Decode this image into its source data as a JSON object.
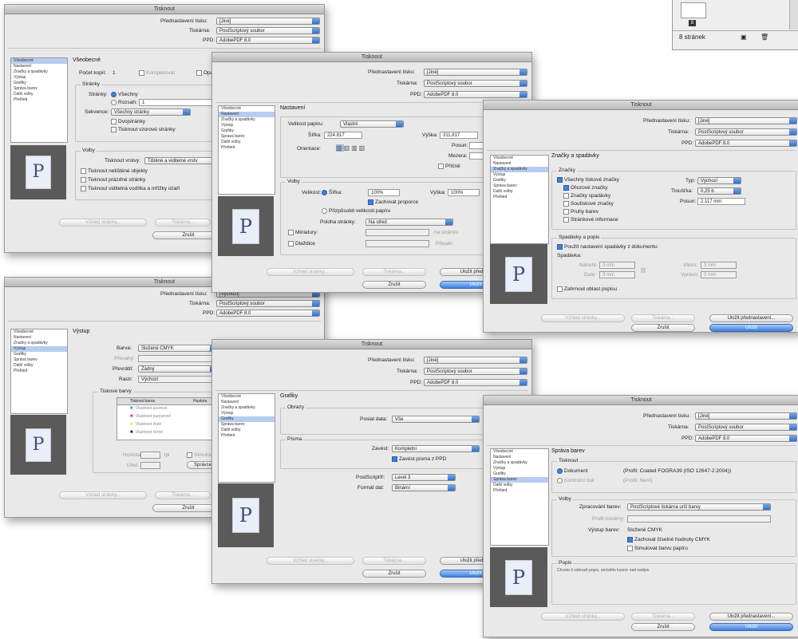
{
  "title": "Tisknout",
  "common": {
    "preset_label": "Přednastavení tisku:",
    "printer_label": "Tiskárna:",
    "ppd_label": "PPD:",
    "preset_value": "[Jiné]",
    "printer_value": "PostScriptový soubor",
    "ppd_value": "AdobePDF 8.0",
    "btn_page_setup": "Vzhled stránky...",
    "btn_printer": "Tiskárna...",
    "btn_save_preset": "Uložit přednastavení...",
    "btn_save_preset_short": "Uložit před",
    "btn_cancel": "Zrušit",
    "btn_save": "Uložit",
    "preview_letter": "P"
  },
  "pages_panel": {
    "count_label": "8 stránek"
  },
  "sidebar": {
    "items": [
      "Všeobecné",
      "Nastavení",
      "Značky a spadávky",
      "Výstup",
      "Grafiky",
      "Správa barev",
      "Další volby",
      "Přehled"
    ]
  },
  "d1": {
    "heading": "Všeobecné",
    "copies_label": "Počet kopií:",
    "copies_value": "1",
    "collate": "Kompletovat",
    "reverse": "Opa",
    "pages_group": "Stránky",
    "pages_label": "Stránky:",
    "all": "Všechny",
    "range": "Rozsah:",
    "range_value": "1",
    "sequence_label": "Sekvence:",
    "sequence_value": "Všechny stránky",
    "spreads": "Dvojstránky",
    "master_pages": "Tisknout vzorové stránky",
    "options_group": "Volby",
    "layers_label": "Tisknout vrstvy:",
    "layers_value": "Tištěné a viditelné vrstv",
    "nonprinting": "Tisknout netištěné objekty",
    "blank": "Tisknout prázdné stránky",
    "guides": "Tisknout viditelná vodítka a mřížky účaří"
  },
  "d2": {
    "heading": "Nastavení",
    "paper_label": "Velikost papíru:",
    "paper_value": "Vlastní",
    "width_label": "Šířka:",
    "width_value": "224.817",
    "height_label": "Výška:",
    "height_value": "311.817",
    "offset_label": "Posun:",
    "gap_label": "Mezera:",
    "orientation_label": "Orientace:",
    "transverse": "Příčně",
    "options_group": "Volby",
    "scale_label": "Velikost:",
    "scale_width": "Šířka:",
    "scale_width_value": "100%",
    "scale_height": "Výška:",
    "scale_height_value": "100%",
    "constrain": "Zachovat proporce",
    "fit": "Přizpůsobit velikosti papíru",
    "position_label": "Poloha stránky:",
    "position_value": "Na střed",
    "thumbnails": "Miniatury:",
    "per_page": "na stránku",
    "tile": "Dlaždice",
    "overlap": "Přesah:"
  },
  "d3": {
    "heading": "Značky a spadávky",
    "marks_group": "Značky",
    "all_marks": "Všechny tiskové značky",
    "crop": "Ořezové značky",
    "bleed_marks": "Značky spadávky",
    "reg": "Soutiskové značky",
    "color_bars": "Pruhy barev",
    "page_info": "Stránkové informace",
    "type_label": "Typ:",
    "type_value": "Výchozí",
    "weight_label": "Tloušťka:",
    "weight_value": "0,25 b",
    "offset_label": "Posun:",
    "offset_value": "2.117 mm",
    "bleed_group": "Spadávky a popis",
    "use_doc_bleed": "Použít nastavení spadávky z dokumentu",
    "bleed_label": "Spadávka:",
    "top_label": "Nahoře:",
    "bottom_label": "Dole:",
    "left_label": "Vlevo:",
    "right_label": "Vpravo:",
    "bleed_value": "3 mm",
    "slug": "Zahrnout oblast popisu"
  },
  "d4": {
    "preset_value": "[Výchozí]",
    "heading": "Výstup",
    "color_label": "Barva:",
    "color_value": "Složené CMYK",
    "trap_label": "Přesahy:",
    "flip_label": "Převrátit:",
    "flip_value": "Žádný",
    "screen_label": "Rastr:",
    "screen_value": "Výchozí",
    "inks_group": "Tiskové barvy",
    "ink_col": "Tisková barva",
    "freq_col": "Hustota",
    "inks": [
      "Vlastnost azurové",
      "Vlastnost purpurové",
      "Vlastnost žluté",
      "Vlastnost černé"
    ],
    "freq_label": "Hustota:",
    "lpi": "lpi",
    "angle_label": "Úhel:",
    "simulate": "Simulovat",
    "ink_manager": "Správce"
  },
  "d5": {
    "heading": "Grafiky",
    "images_group": "Obrazy",
    "send_label": "Poslat data:",
    "send_value": "Vše",
    "fonts_group": "Písma",
    "download_label": "Zavést:",
    "download_value": "Kompletní",
    "ppd_fonts": "Zavést písma z PPD",
    "ps_label": "PostScript®:",
    "ps_value": "Level 3",
    "format_label": "Formát dat:",
    "format_value": "Binární"
  },
  "d6": {
    "heading": "Správa barev",
    "print_group": "Tisknout",
    "document": "Dokument",
    "doc_profile": "(Profil: Coated FOGRA39 (ISO 12647-2:2004))",
    "proof": "Kontrolní tisk",
    "proof_profile": "(Profil: Není)",
    "options_group": "Volby",
    "handling_label": "Zpracování barev:",
    "handling_value": "PostScriptové tiskárna určí barvy",
    "printer_profile_label": "Profil tiskárny:",
    "output_label": "Výstup barev:",
    "output_value": "Složené CMYK",
    "preserve": "Zachovat číselné hodnoty CMYK",
    "simulate": "Simulovat barvu papíru",
    "desc_group": "Popis",
    "desc_text": "Chcete-li zobrazit popis, umístěte kurzor nad nadpis."
  },
  "colors": {
    "accent": "#3d7fdc",
    "preview_bg": "#5a5a5a",
    "dialog_bg": "#e9e9e9"
  }
}
